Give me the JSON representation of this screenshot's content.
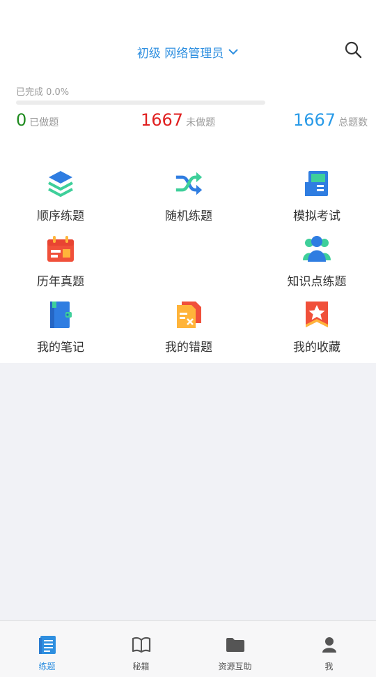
{
  "header": {
    "title": "初级 网络管理员",
    "title_color": "#2e8fe0"
  },
  "progress": {
    "label": "已完成 0.0%",
    "fraction": 0.0
  },
  "stats": {
    "done": {
      "value": "0",
      "label": "已做题",
      "color": "#1f8b1f"
    },
    "undone": {
      "value": "1667",
      "label": "未做题",
      "color": "#e02020"
    },
    "total": {
      "value": "1667",
      "label": "总题数",
      "color": "#2a9be8"
    }
  },
  "menu": {
    "sequential": {
      "label": "顺序练题",
      "icon": "layers-icon"
    },
    "random": {
      "label": "随机练题",
      "icon": "shuffle-icon"
    },
    "mock_exam": {
      "label": "模拟考试",
      "icon": "exam-book-icon"
    },
    "past_papers": {
      "label": "历年真题",
      "icon": "calendar-icon"
    },
    "knowledge": {
      "label": "知识点练题",
      "icon": "people-icon"
    },
    "notes": {
      "label": "我的笔记",
      "icon": "notebook-icon"
    },
    "mistakes": {
      "label": "我的错题",
      "icon": "error-doc-icon"
    },
    "favorites": {
      "label": "我的收藏",
      "icon": "star-bookmark-icon"
    }
  },
  "tabbar": {
    "practice": {
      "label": "练题",
      "icon": "document-icon",
      "active": true
    },
    "secrets": {
      "label": "秘籍",
      "icon": "open-book-icon"
    },
    "resources": {
      "label": "资源互助",
      "icon": "folder-icon"
    },
    "me": {
      "label": "我",
      "icon": "person-icon"
    }
  }
}
